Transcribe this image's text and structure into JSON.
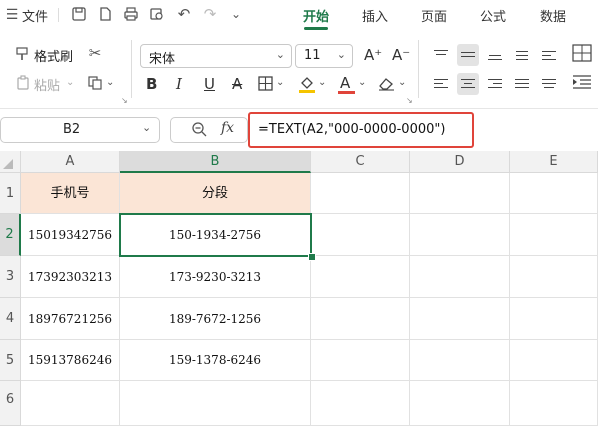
{
  "menubar": {
    "file_label": "文件",
    "tabs": [
      {
        "label": "开始",
        "active": true
      },
      {
        "label": "插入",
        "active": false
      },
      {
        "label": "页面",
        "active": false
      },
      {
        "label": "公式",
        "active": false
      },
      {
        "label": "数据",
        "active": false
      }
    ]
  },
  "ribbon": {
    "format_painter_label": "格式刷",
    "paste_label": "粘贴",
    "font_name": "宋体",
    "font_size": "11",
    "bold_label": "B",
    "italic_label": "I",
    "underline_label": "U",
    "strike_label": "A",
    "grow_font_label": "A⁺",
    "shrink_font_label": "A⁻",
    "font_color_label": "A",
    "font_color": "#e0443a",
    "fill_color": "#f5c400"
  },
  "formula_bar": {
    "name_box": "B2",
    "fx_label": "fx",
    "formula": "=TEXT(A2,\"000-0000-0000\")"
  },
  "sheet": {
    "columns": [
      "A",
      "B",
      "C",
      "D",
      "E"
    ],
    "rows": [
      "1",
      "2",
      "3",
      "4",
      "5",
      "6"
    ],
    "selected_cell": "B2",
    "header_fill": "#fbe5d6",
    "accent": "#1f7a4a",
    "cells": {
      "A1": "手机号",
      "B1": "分段",
      "A2": "15019342756",
      "B2": "150-1934-2756",
      "A3": "17392303213",
      "B3": "173-9230-3213",
      "A4": "18976721256",
      "B4": "189-7672-1256",
      "A5": "15913786246",
      "B5": "159-1378-6246"
    }
  }
}
